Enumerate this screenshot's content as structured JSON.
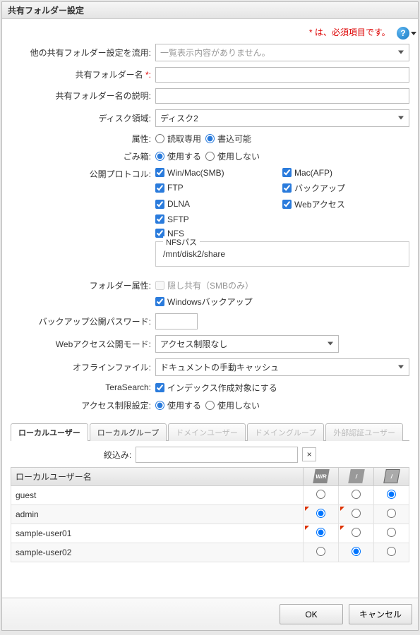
{
  "window_title": "共有フォルダー設定",
  "required_note": "* は、必須項目です。",
  "help_glyph": "?",
  "labels": {
    "reuse": "他の共有フォルダー設定を流用:",
    "name": "共有フォルダー名",
    "name_star": " *:",
    "desc": "共有フォルダー名の説明:",
    "disk": "ディスク領域:",
    "attr": "属性:",
    "trash": "ごみ箱:",
    "proto": "公開プロトコル:",
    "folder_attr": "フォルダー属性:",
    "backup_pw": "バックアップ公開パスワード:",
    "web_mode": "Webアクセス公開モード:",
    "offline": "オフラインファイル:",
    "terasearch": "TeraSearch:",
    "access": "アクセス制限設定:",
    "nfs_legend": "NFSパス",
    "filter_label": "絞込み:"
  },
  "reuse_placeholder": "一覧表示内容がありません。",
  "disk_value": "ディスク2",
  "attr_readonly": "読取専用",
  "attr_writable": "書込可能",
  "trash_use": "使用する",
  "trash_nouse": "使用しない",
  "protocols": {
    "smb": "Win/Mac(SMB)",
    "afp": "Mac(AFP)",
    "ftp": "FTP",
    "backup": "バックアップ",
    "dlna": "DLNA",
    "web": "Webアクセス",
    "sftp": "SFTP",
    "nfs": "NFS"
  },
  "nfs_path": "/mnt/disk2/share",
  "folder_attrs": {
    "hidden": "隠し共有（SMBのみ）",
    "winbackup": "Windowsバックアップ"
  },
  "web_mode_value": "アクセス制限なし",
  "offline_value": "ドキュメントの手動キャッシュ",
  "terasearch_label": "インデックス作成対象にする",
  "access_use": "使用する",
  "access_nouse": "使用しない",
  "tabs": {
    "local_user": "ローカルユーザー",
    "local_group": "ローカルグループ",
    "domain_user": "ドメインユーザー",
    "domain_group": "ドメイングループ",
    "ext_auth": "外部認証ユーザー"
  },
  "grid_header_name": "ローカルユーザー名",
  "perm_head_wr": "W/R",
  "users": [
    {
      "name": "guest"
    },
    {
      "name": "admin"
    },
    {
      "name": "sample-user01"
    },
    {
      "name": "sample-user02"
    }
  ],
  "buttons": {
    "ok": "OK",
    "cancel": "キャンセル"
  }
}
